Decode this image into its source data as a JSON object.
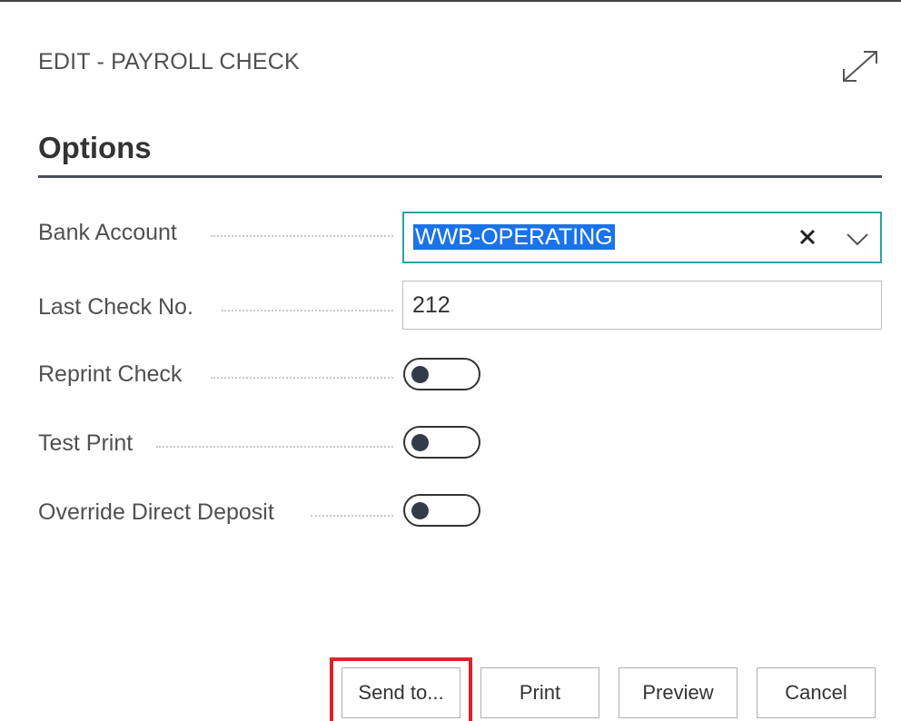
{
  "dialog": {
    "title": "EDIT - PAYROLL CHECK",
    "expand_icon": "expand-arrows-icon"
  },
  "section": {
    "heading": "Options"
  },
  "fields": {
    "bank_account": {
      "label": "Bank Account",
      "value": "WWB-OPERATING",
      "clear_icon": "close-icon",
      "dropdown_icon": "chevron-down-icon"
    },
    "last_check_no": {
      "label": "Last Check No.",
      "value": "212"
    },
    "reprint_check": {
      "label": "Reprint Check",
      "checked": false
    },
    "test_print": {
      "label": "Test Print",
      "checked": false
    },
    "override_direct_deposit": {
      "label": "Override Direct Deposit",
      "checked": false
    }
  },
  "buttons": {
    "send_to": "Send to...",
    "print": "Print",
    "preview": "Preview",
    "cancel": "Cancel"
  },
  "colors": {
    "focus_border": "#2aa3a8",
    "selection": "#1a73e8",
    "highlight_frame": "#e0202a",
    "toggle_knob": "#333b48"
  }
}
